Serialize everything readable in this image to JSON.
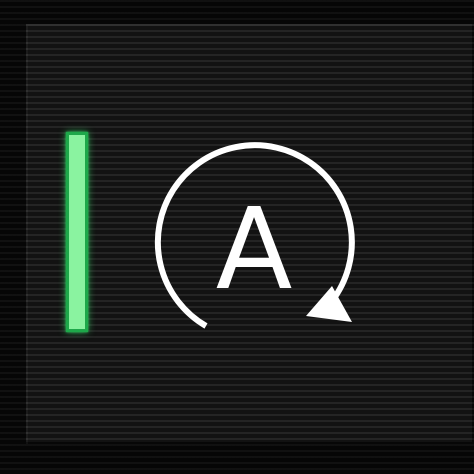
{
  "control": {
    "icon_letter": "A",
    "icon": "auto-start-stop-icon",
    "indicator_state": "on",
    "indicator_color": "#3ddc6a",
    "icon_color": "#ffffff"
  }
}
